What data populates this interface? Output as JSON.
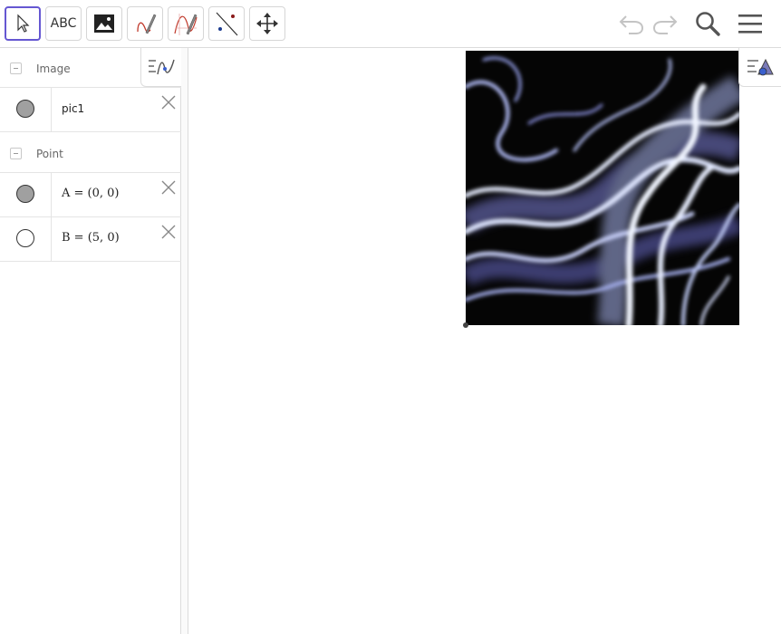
{
  "toolbar": {
    "tools": [
      {
        "name": "move-tool",
        "icon": "arrow-cursor-icon",
        "selected": true
      },
      {
        "name": "text-tool",
        "icon": "text-icon",
        "label": "ABC"
      },
      {
        "name": "image-tool",
        "icon": "image-icon"
      },
      {
        "name": "pen-tool",
        "icon": "pen-icon"
      },
      {
        "name": "function-inspector-tool",
        "icon": "function-pen-icon"
      },
      {
        "name": "line-tool",
        "icon": "line-through-points-icon"
      },
      {
        "name": "move-graphics-view-tool",
        "icon": "move-arrows-icon"
      }
    ],
    "right": [
      {
        "name": "undo-button",
        "icon": "undo-icon"
      },
      {
        "name": "redo-button",
        "icon": "redo-icon"
      },
      {
        "name": "search-button",
        "icon": "search-icon"
      },
      {
        "name": "menu-button",
        "icon": "hamburger-menu-icon"
      }
    ],
    "accent": "#6557d2"
  },
  "algebra": {
    "groups": [
      {
        "label": "Image",
        "items": [
          {
            "text": "pic1",
            "marble_filled": true
          }
        ]
      },
      {
        "label": "Point",
        "items": [
          {
            "text": "A = (0, 0)",
            "marble_filled": true
          },
          {
            "text": "B = (5, 0)",
            "marble_filled": false
          }
        ]
      }
    ]
  },
  "colors": {
    "marble_fill": "#a0a0a0",
    "image_bg": "#050505",
    "smoke": "#c9d4ff"
  }
}
